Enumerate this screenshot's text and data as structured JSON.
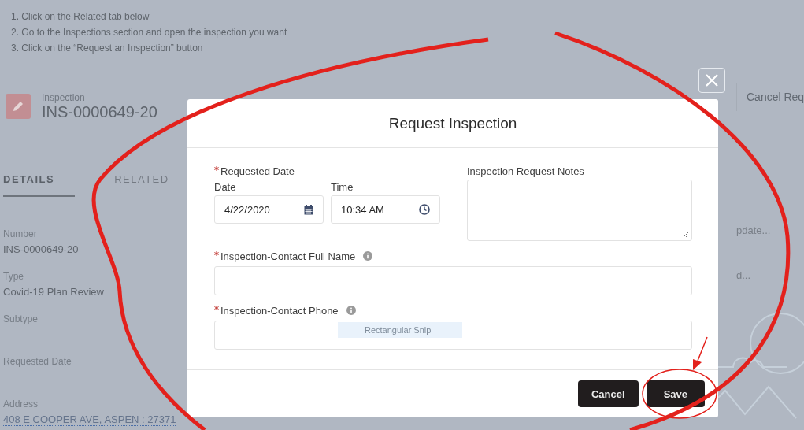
{
  "instructions": [
    "1. Click on the Related tab below",
    "2. Go to the Inspections section and open the inspection you want",
    "3. Click on the “Request an Inspection” button"
  ],
  "record": {
    "object_type": "Inspection",
    "name": "INS-0000649-20"
  },
  "header_actions": [
    {
      "label": "Cancel Req"
    }
  ],
  "tabs": [
    {
      "label": "DETAILS",
      "selected": true
    },
    {
      "label": "RELATED",
      "selected": false
    }
  ],
  "fields": [
    {
      "label": "Number",
      "value": "INS-0000649-20",
      "kind": "text"
    },
    {
      "label": "Type",
      "value": "Covid-19 Plan Review",
      "kind": "text"
    },
    {
      "label": "Subtype",
      "kind": "text"
    },
    {
      "label": "Requested Date",
      "kind": "text"
    },
    {
      "label": "Address",
      "value": "408 E COOPER AVE, ASPEN : 27371",
      "kind": "link"
    }
  ],
  "right_column": [
    "pdate...",
    "d..."
  ],
  "modal": {
    "title": "Request Inspection",
    "requested_date": {
      "label": "Requested Date",
      "required": true,
      "date_label": "Date",
      "date_value": "4/22/2020",
      "time_label": "Time",
      "time_value": "10:34 AM"
    },
    "notes": {
      "label": "Inspection Request Notes",
      "required": false
    },
    "contact_name": {
      "label": "Inspection-Contact Full Name",
      "required": true
    },
    "contact_phone": {
      "label": "Inspection-Contact Phone",
      "required": true
    },
    "tooltip": "Rectangular Snip",
    "buttons": [
      {
        "label": "Cancel"
      },
      {
        "label": "Save"
      }
    ]
  }
}
